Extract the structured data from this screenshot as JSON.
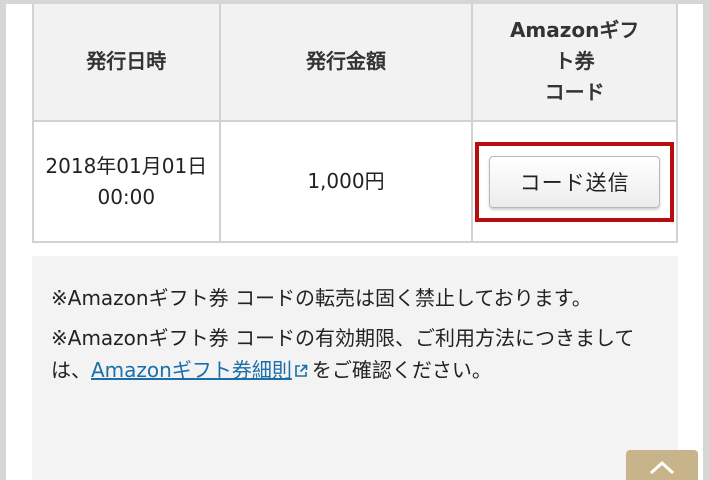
{
  "table": {
    "headers": [
      "発行日時",
      "発行金額",
      "Amazonギフト券\nコード"
    ],
    "rows": [
      {
        "issued_at": "2018年01月01日 00:00",
        "amount": "1,000円",
        "action_label": "コード送信"
      }
    ]
  },
  "notes": {
    "note1": "※Amazonギフト券 コードの転売は固く禁止しております。",
    "note2_before": "※Amazonギフト券 コードの有効期限、ご利用方法につきましては、",
    "note2_link": "Amazonギフト券細則",
    "note2_after": "をご確認ください。"
  },
  "icons": {
    "external_link": "external-link-icon",
    "back_to_top": "chevron-up-icon"
  },
  "colors": {
    "highlight_border": "#b70d0d",
    "link": "#1a6fa8",
    "header_bg": "#f2f2f2",
    "notes_bg": "#f3f3f3"
  }
}
